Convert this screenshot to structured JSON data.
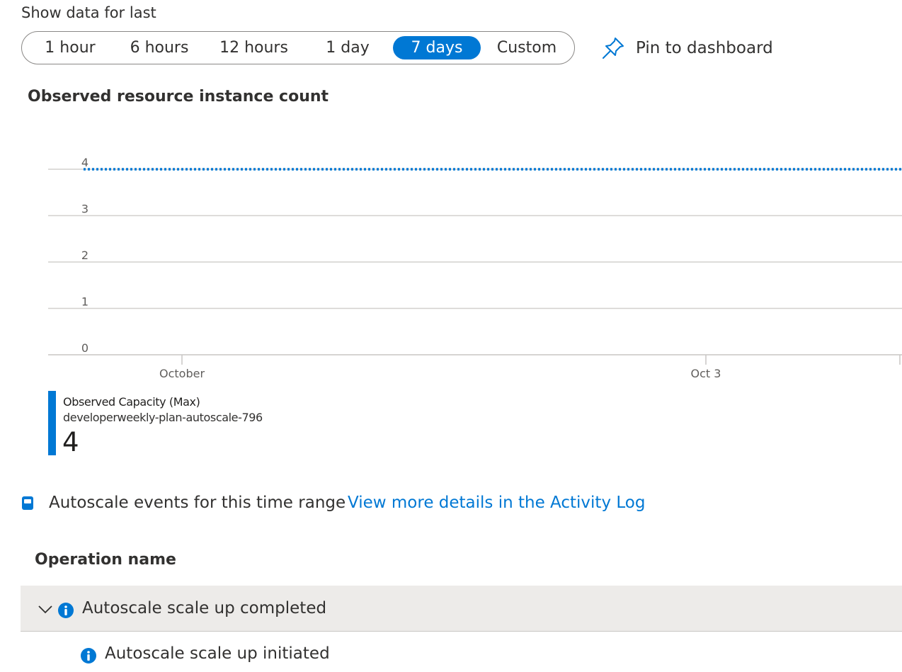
{
  "time_range": {
    "label": "Show data for last",
    "options": [
      "1 hour",
      "6 hours",
      "12 hours",
      "1 day",
      "7 days",
      "Custom"
    ],
    "selected": "7 days"
  },
  "pin": {
    "label": "Pin to dashboard",
    "icon": "pin-icon"
  },
  "chart_title": "Observed resource instance count",
  "chart_data": {
    "type": "line",
    "title": "Observed resource instance count",
    "xlabel": "",
    "ylabel": "",
    "ylim": [
      0,
      4
    ],
    "yticks": [
      "0",
      "1",
      "2",
      "3",
      "4"
    ],
    "xticks": [
      "October",
      "Oct 3"
    ],
    "grid": true,
    "series": [
      {
        "name": "Observed Capacity (Max)",
        "style": "dotted",
        "color": "#0078d4",
        "values": [
          4,
          4
        ]
      }
    ]
  },
  "legend": {
    "name": "Observed Capacity (Max)",
    "resource": "developerweekly-plan-autoscale-796",
    "value": "4",
    "color": "#0078d4"
  },
  "events": {
    "icon": "log-icon",
    "text": "Autoscale events for this time range",
    "link": "View more details in the Activity Log"
  },
  "table": {
    "column": "Operation name",
    "rows": [
      {
        "label": "Autoscale scale up completed",
        "icon": "info-icon",
        "expanded": true
      },
      {
        "label": "Autoscale scale up initiated",
        "icon": "info-icon"
      }
    ]
  }
}
